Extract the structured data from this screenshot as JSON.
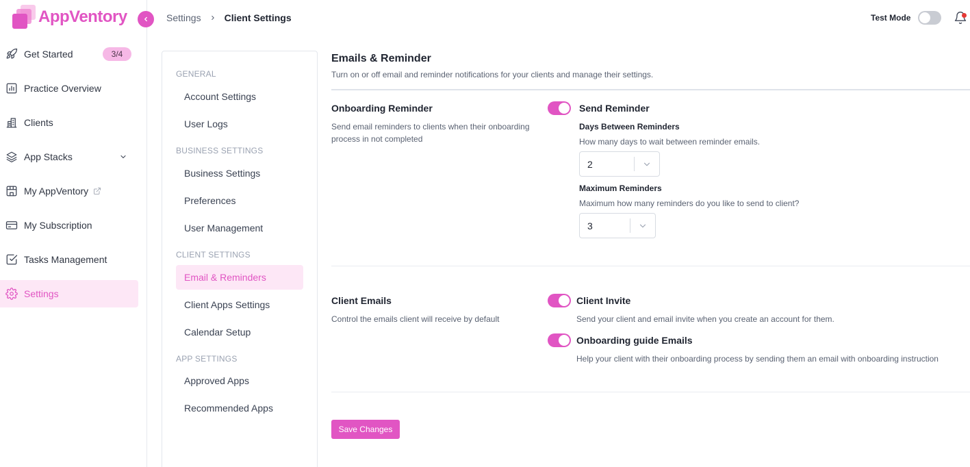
{
  "app": {
    "brand": "AppVentory",
    "accent_color": "#e155c3"
  },
  "sidebar": {
    "items": [
      {
        "label": "Get Started",
        "icon": "rocket-icon",
        "badge": "3/4"
      },
      {
        "label": "Practice Overview",
        "icon": "chart-icon"
      },
      {
        "label": "Clients",
        "icon": "building-icon"
      },
      {
        "label": "App Stacks",
        "icon": "layers-icon",
        "has_chevron": true
      },
      {
        "label": "My AppVentory",
        "icon": "store-icon",
        "external": true
      },
      {
        "label": "My Subscription",
        "icon": "credit-card-icon"
      },
      {
        "label": "Tasks Management",
        "icon": "checkbox-icon"
      },
      {
        "label": "Settings",
        "icon": "gear-icon",
        "active": true
      }
    ]
  },
  "header": {
    "breadcrumb": [
      "Settings",
      "Client Settings"
    ],
    "test_mode_label": "Test Mode",
    "test_mode_on": false
  },
  "submenu": {
    "sections": [
      {
        "title": "GENERAL",
        "items": [
          "Account Settings",
          "User Logs"
        ]
      },
      {
        "title": "BUSINESS SETTINGS",
        "items": [
          "Business Settings",
          "Preferences",
          "User Management"
        ]
      },
      {
        "title": "CLIENT SETTINGS",
        "items": [
          "Email & Reminders",
          "Client Apps Settings",
          "Calendar Setup"
        ]
      },
      {
        "title": "APP SETTINGS",
        "items": [
          "Approved Apps",
          "Recommended Apps"
        ]
      }
    ],
    "active_item": "Email & Reminders"
  },
  "main": {
    "title": "Emails & Reminder",
    "description": "Turn on or off email and reminder notifications for your clients and manage their settings.",
    "onboarding": {
      "title": "Onboarding Reminder",
      "description": "Send email reminders to clients when their onboarding process in not completed",
      "send_reminder": {
        "label": "Send Reminder",
        "enabled": true
      },
      "days_between": {
        "label": "Days Between Reminders",
        "help": "How many days to wait between reminder emails.",
        "value": "2"
      },
      "max_reminders": {
        "label": "Maximum Reminders",
        "help": "Maximum how many reminders do you like to send to client?",
        "value": "3"
      }
    },
    "client_emails": {
      "title": "Client Emails",
      "description": "Control the emails client will receive by default",
      "client_invite": {
        "label": "Client Invite",
        "help": "Send your client and email invite when you create an account for them.",
        "enabled": true
      },
      "onboarding_guide": {
        "label": "Onboarding guide Emails",
        "help": "Help your client with their onboarding process by sending them an email with onboarding instruction",
        "enabled": true
      }
    },
    "save_label": "Save Changes"
  }
}
